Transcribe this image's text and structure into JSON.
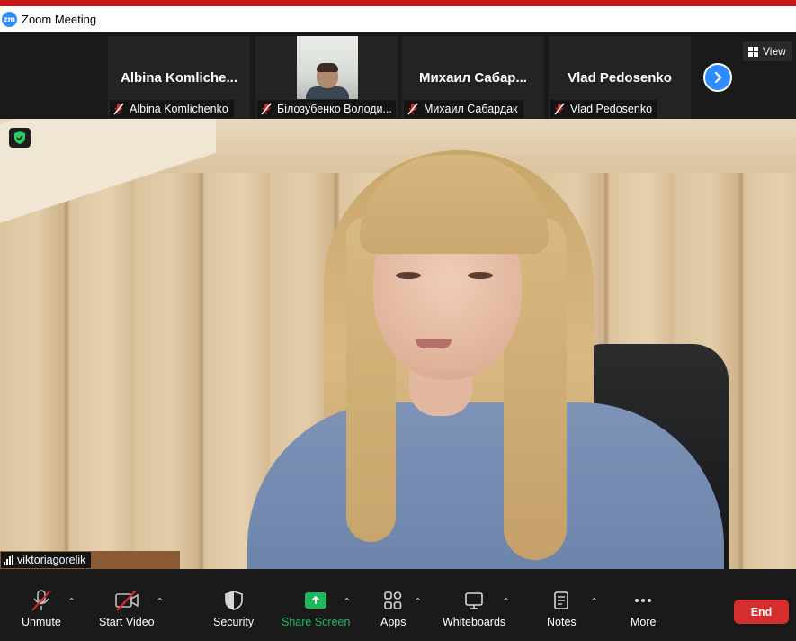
{
  "window": {
    "title": "Zoom Meeting",
    "app_icon_text": "zm"
  },
  "participants": [
    {
      "display_name": "Albina  Komliche...",
      "label": "Albina Komlichenko",
      "muted": true
    },
    {
      "display_name": "",
      "label": "Білозубенко Володи...",
      "muted": true,
      "has_video": true
    },
    {
      "display_name": "Михаил  Сабар...",
      "label": "Михаил Сабардак",
      "muted": true
    },
    {
      "display_name": "Vlad Pedosenko",
      "label": "Vlad Pedosenko",
      "muted": true
    }
  ],
  "view_button": {
    "label": "View"
  },
  "main_video": {
    "name": "viktoriagorelik"
  },
  "toolbar": {
    "unmute": "Unmute",
    "start_video": "Start Video",
    "security": "Security",
    "share_screen": "Share Screen",
    "apps": "Apps",
    "whiteboards": "Whiteboards",
    "notes": "Notes",
    "more": "More",
    "end": "End"
  },
  "colors": {
    "accent": "#2d8cff",
    "share_green": "#21b85b",
    "end_red": "#d62d2f",
    "muted_red": "#e02828",
    "title_red_bar": "#c9181b"
  }
}
